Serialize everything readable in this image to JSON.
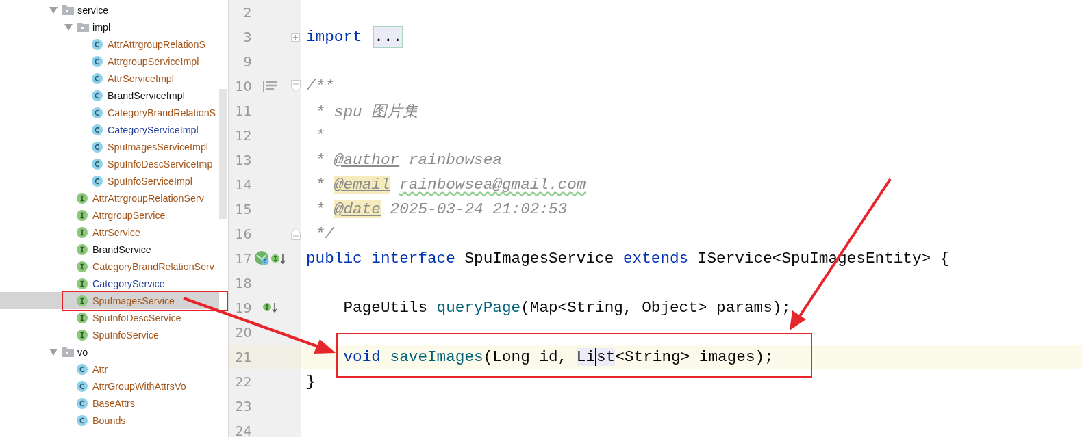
{
  "project_tree": {
    "items": [
      {
        "label": "service",
        "kind": "folder",
        "expanded": true,
        "selected": false,
        "color": "#111111",
        "children": [
          {
            "label": "impl",
            "kind": "folder",
            "expanded": true,
            "selected": false,
            "color": "#111111",
            "children": [
              {
                "label": "AttrAttrgroupRelationS",
                "kind": "class",
                "selected": false,
                "color": "#a3561c"
              },
              {
                "label": "AttrgroupServiceImpl",
                "kind": "class",
                "selected": false,
                "color": "#a3561c"
              },
              {
                "label": "AttrServiceImpl",
                "kind": "class",
                "selected": false,
                "color": "#a3561c"
              },
              {
                "label": "BrandServiceImpl",
                "kind": "class",
                "selected": false,
                "color": "#111111"
              },
              {
                "label": "CategoryBrandRelationS",
                "kind": "class",
                "selected": false,
                "color": "#a3561c"
              },
              {
                "label": "CategoryServiceImpl",
                "kind": "class",
                "selected": false,
                "color": "#22409c"
              },
              {
                "label": "SpuImagesServiceImpl",
                "kind": "class",
                "selected": false,
                "color": "#a3561c"
              },
              {
                "label": "SpuInfoDescServiceImp",
                "kind": "class",
                "selected": false,
                "color": "#a3561c"
              },
              {
                "label": "SpuInfoServiceImpl",
                "kind": "class",
                "selected": false,
                "color": "#a3561c"
              }
            ]
          },
          {
            "label": "AttrAttrgroupRelationServ",
            "kind": "interface",
            "selected": false,
            "color": "#a3561c"
          },
          {
            "label": "AttrgroupService",
            "kind": "interface",
            "selected": false,
            "color": "#a3561c"
          },
          {
            "label": "AttrService",
            "kind": "interface",
            "selected": false,
            "color": "#a3561c"
          },
          {
            "label": "BrandService",
            "kind": "interface",
            "selected": false,
            "color": "#111111"
          },
          {
            "label": "CategoryBrandRelationServ",
            "kind": "interface",
            "selected": false,
            "color": "#a3561c"
          },
          {
            "label": "CategoryService",
            "kind": "interface",
            "selected": false,
            "color": "#22409c"
          },
          {
            "label": "SpuImagesService",
            "kind": "interface",
            "selected": true,
            "color": "#a3561c"
          },
          {
            "label": "SpuInfoDescService",
            "kind": "interface",
            "selected": false,
            "color": "#a3561c"
          },
          {
            "label": "SpuInfoService",
            "kind": "interface",
            "selected": false,
            "color": "#a3561c"
          }
        ]
      },
      {
        "label": "vo",
        "kind": "folder",
        "expanded": true,
        "selected": false,
        "color": "#111111",
        "children": [
          {
            "label": "Attr",
            "kind": "class",
            "selected": false,
            "color": "#a3561c"
          },
          {
            "label": "AttrGroupWithAttrsVo",
            "kind": "class",
            "selected": false,
            "color": "#a3561c"
          },
          {
            "label": "BaseAttrs",
            "kind": "class",
            "selected": false,
            "color": "#a3561c"
          },
          {
            "label": "Bounds",
            "kind": "class",
            "selected": false,
            "color": "#a3561c"
          }
        ]
      }
    ]
  },
  "editor": {
    "lines": [
      {
        "number": "2",
        "current": false
      },
      {
        "number": "3",
        "current": false,
        "fold": {
          "kind": "expand"
        },
        "tokens": [
          {
            "text": "import ",
            "kind": "keyword"
          },
          {
            "text": "...",
            "kind": "folded"
          }
        ]
      },
      {
        "number": "9",
        "current": false
      },
      {
        "number": "10",
        "current": false,
        "fold": {
          "kind": "collapse"
        },
        "marker": {
          "kind": "doc"
        },
        "tokens": [
          {
            "text": "/**",
            "kind": "comment"
          }
        ]
      },
      {
        "number": "11",
        "current": false,
        "tokens": [
          {
            "text": " * spu 图片集",
            "kind": "comment"
          }
        ]
      },
      {
        "number": "12",
        "current": false,
        "tokens": [
          {
            "text": " *",
            "kind": "comment"
          }
        ]
      },
      {
        "number": "13",
        "current": false,
        "tokens": [
          {
            "text": " * ",
            "kind": "comment"
          },
          {
            "text": "@author",
            "kind": "doctag"
          },
          {
            "text": " rainbowsea",
            "kind": "comment"
          }
        ]
      },
      {
        "number": "14",
        "current": false,
        "tokens": [
          {
            "text": " * ",
            "kind": "comment"
          },
          {
            "text": "@email",
            "kind": "doctag-marked"
          },
          {
            "text": "rainbowsea@gmail.com",
            "kind": "typo"
          }
        ]
      },
      {
        "number": "15",
        "current": false,
        "tokens": [
          {
            "text": " * ",
            "kind": "comment"
          },
          {
            "text": "@date",
            "kind": "doctag-marked"
          },
          {
            "text": " 2025-03-24 21:02:53",
            "kind": "comment"
          }
        ]
      },
      {
        "number": "16",
        "current": false,
        "fold": {
          "kind": "end"
        },
        "tokens": [
          {
            "text": " */",
            "kind": "comment"
          }
        ]
      },
      {
        "number": "17",
        "current": false,
        "marker": {
          "kind": "implemented-twice"
        },
        "tokens": [
          {
            "text": "public interface",
            "kind": "keyword"
          },
          {
            "text": " SpuImagesService ",
            "kind": "plain"
          },
          {
            "text": "extends",
            "kind": "keyword"
          },
          {
            "text": " IService<SpuImagesEntity> {",
            "kind": "plain"
          }
        ]
      },
      {
        "number": "18",
        "current": false
      },
      {
        "number": "19",
        "current": false,
        "marker": {
          "kind": "implemented"
        },
        "tokens": [
          {
            "text": "    PageUtils ",
            "kind": "plain"
          },
          {
            "text": "queryPage",
            "kind": "method"
          },
          {
            "text": "(Map<String, Object> params);",
            "kind": "plain"
          }
        ]
      },
      {
        "number": "20",
        "current": false
      },
      {
        "number": "21",
        "current": true,
        "tokens": [
          {
            "text": "    void ",
            "kind": "keyword"
          },
          {
            "text": "saveImages",
            "kind": "method"
          },
          {
            "text": "(Long id, ",
            "kind": "plain"
          },
          {
            "text": "Li",
            "kind": "ref-caret"
          },
          {
            "text": "st",
            "kind": "ref"
          },
          {
            "text": "<String> images);",
            "kind": "plain"
          }
        ]
      },
      {
        "number": "22",
        "current": false,
        "tokens": [
          {
            "text": "}",
            "kind": "plain"
          }
        ]
      },
      {
        "number": "23",
        "current": false
      },
      {
        "number": "24",
        "current": false
      }
    ]
  }
}
